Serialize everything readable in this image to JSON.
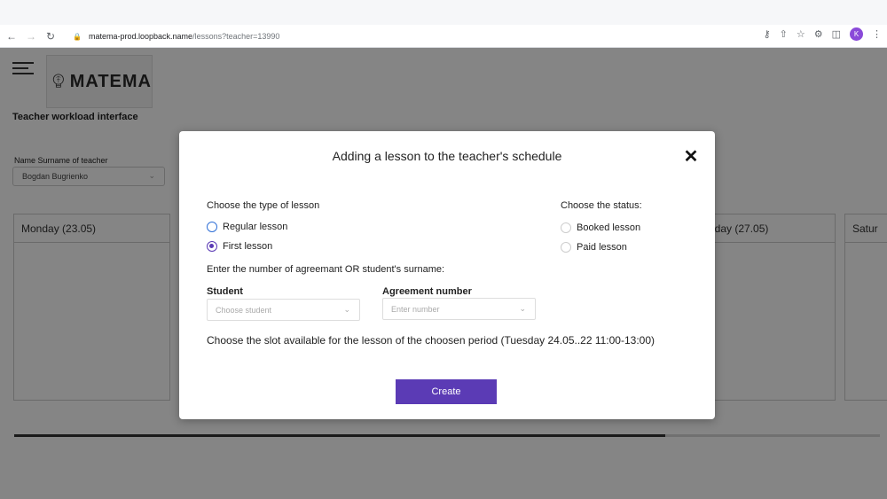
{
  "browser": {
    "url_host": "matema-prod.loopback.name",
    "url_path": "/lessons?teacher=13990",
    "profile_initial": "K"
  },
  "app": {
    "logo_text": "MATEMA",
    "page_title": "Teacher workload interface",
    "teacher_label": "Name Surname of teacher",
    "teacher_value": "Bogdan Bugrienko",
    "days": [
      "Monday  (23.05)",
      "riday (27.05)",
      "Satur"
    ]
  },
  "modal": {
    "title": "Adding a lesson to the teacher's schedule",
    "lesson_type_label": "Choose the type of lesson",
    "lesson_types": [
      "Regular lesson",
      "First lesson"
    ],
    "selected_lesson_type": "First lesson",
    "status_label": "Choose the status:",
    "statuses": [
      "Booked lesson",
      "Paid lesson"
    ],
    "agreement_prompt": "Enter the number of  agreemant OR student's surname:",
    "student_label": "Student",
    "student_placeholder": "Choose student",
    "agreement_label": "Agreement number",
    "agreement_placeholder": "Enter number",
    "slot_text": "Choose the slot available for the lesson of the choosen period  (Tuesday 24.05..22 11:00-13:00)",
    "create_label": "Create"
  },
  "colors": {
    "accent": "#5b3bb5",
    "radio_blue": "#2f6fd6"
  }
}
